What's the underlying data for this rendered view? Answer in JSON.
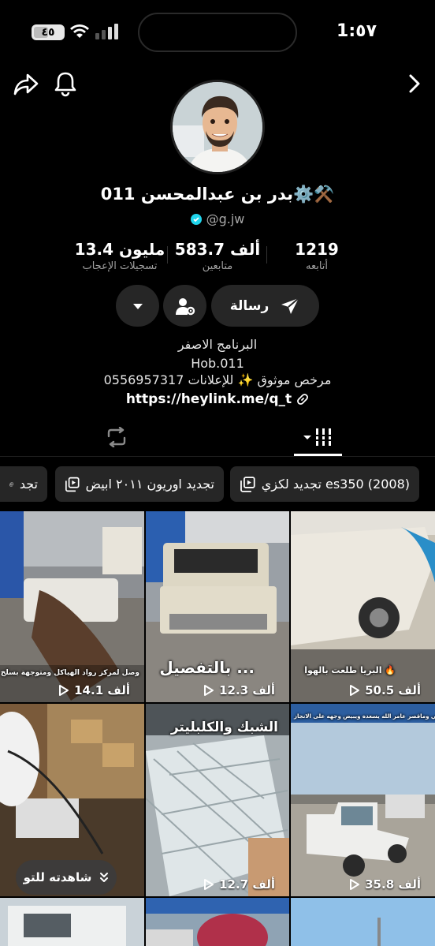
{
  "status": {
    "time": "1:٥٧",
    "battery": "٤٥"
  },
  "profile": {
    "name": "بدر بن عبدالمحسن 011⚙️⚒️",
    "handle": "@g.jw"
  },
  "stats": {
    "likes_value": "13.4 مليون",
    "likes_label": "تسجيلات الإعجاب",
    "followers_value": "583.7 ألف",
    "followers_label": "متابعين",
    "following_value": "1219",
    "following_label": "أتابعه"
  },
  "buttons": {
    "message_label": "رسالة"
  },
  "bio": {
    "line1": "البرنامج الاصفر",
    "line2": "Hob.011",
    "line3": "مرخص موثوق ✨ للإعلانات 0556957317",
    "link": "https://heylink.me/q_t"
  },
  "playlists": [
    {
      "title": "تجديد لكزي es350 (2008)"
    },
    {
      "title": "تجديد اوريون ٢٠١١ ابيض"
    },
    {
      "title": "تجد"
    }
  ],
  "videos": [
    {
      "views": "14.1 ألف",
      "caption": "وصل لمركز رواد الهياكل ومتوجهة بسلخ كامل"
    },
    {
      "views": "12.3 ألف",
      "caption": "بالتفصيل ..."
    },
    {
      "views": "50.5 ألف",
      "caption": "البريا طلعت بالهوا 🔥"
    },
    {
      "views": "",
      "caption": ""
    },
    {
      "views": "12.7 ألف",
      "caption": "الشبك والكلبليتر"
    },
    {
      "views": "35.8 ألف",
      "caption": "رهفا ثم قحص 'المتبقي وماقصر عامر الله يسعده ويبيض وجهه على الانجاز"
    }
  ],
  "watched_label": "شاهدته للتو",
  "colors": {
    "accent": "#20d5ec",
    "button_bg": "#262626",
    "background": "#000000"
  }
}
